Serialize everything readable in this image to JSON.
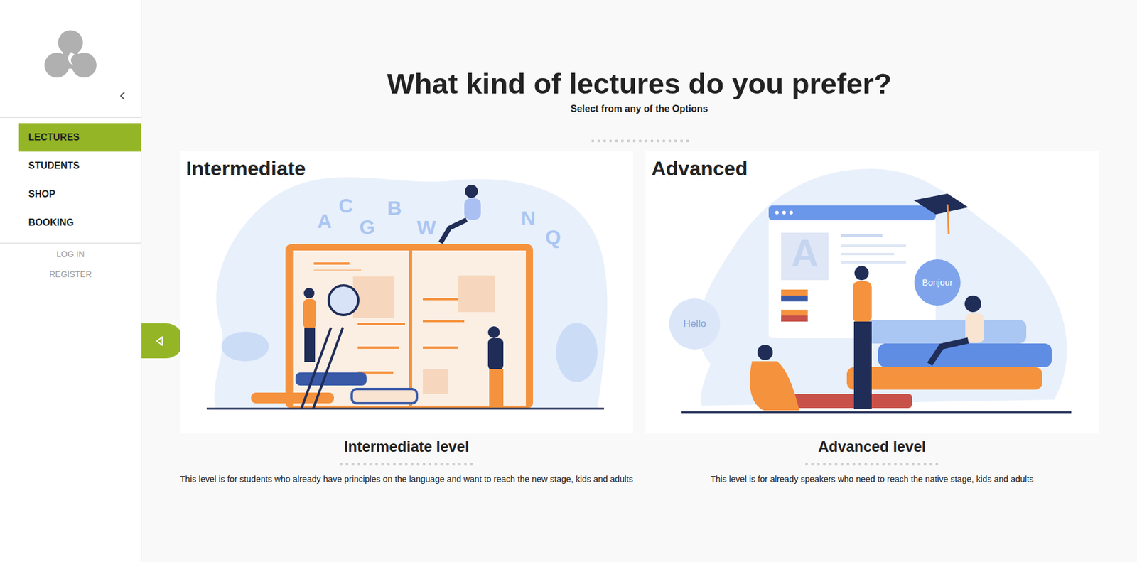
{
  "sidebar": {
    "items": [
      {
        "label": "LECTURES",
        "selected": true
      },
      {
        "label": "STUDENTS",
        "selected": false
      },
      {
        "label": "SHOP",
        "selected": false
      },
      {
        "label": "BOOKING",
        "selected": false
      }
    ],
    "auth": [
      "LOG IN",
      "REGISTER"
    ]
  },
  "page": {
    "title": "What kind of lectures do you prefer?",
    "subtitle": "Select from any of the Options"
  },
  "cards": [
    {
      "label": "Intermediate",
      "title": "Intermediate level",
      "description": "This level is for students who already have principles on the language and want to reach the new stage, kids and adults",
      "illustration_text": [
        "A",
        "C",
        "G",
        "B",
        "W",
        "N",
        "Q"
      ]
    },
    {
      "label": "Advanced",
      "title": "Advanced level",
      "description": "This level is for already speakers who need to reach the native stage, kids and adults",
      "illustration_text": [
        "A",
        "Hello",
        "Bonjour"
      ]
    }
  ]
}
